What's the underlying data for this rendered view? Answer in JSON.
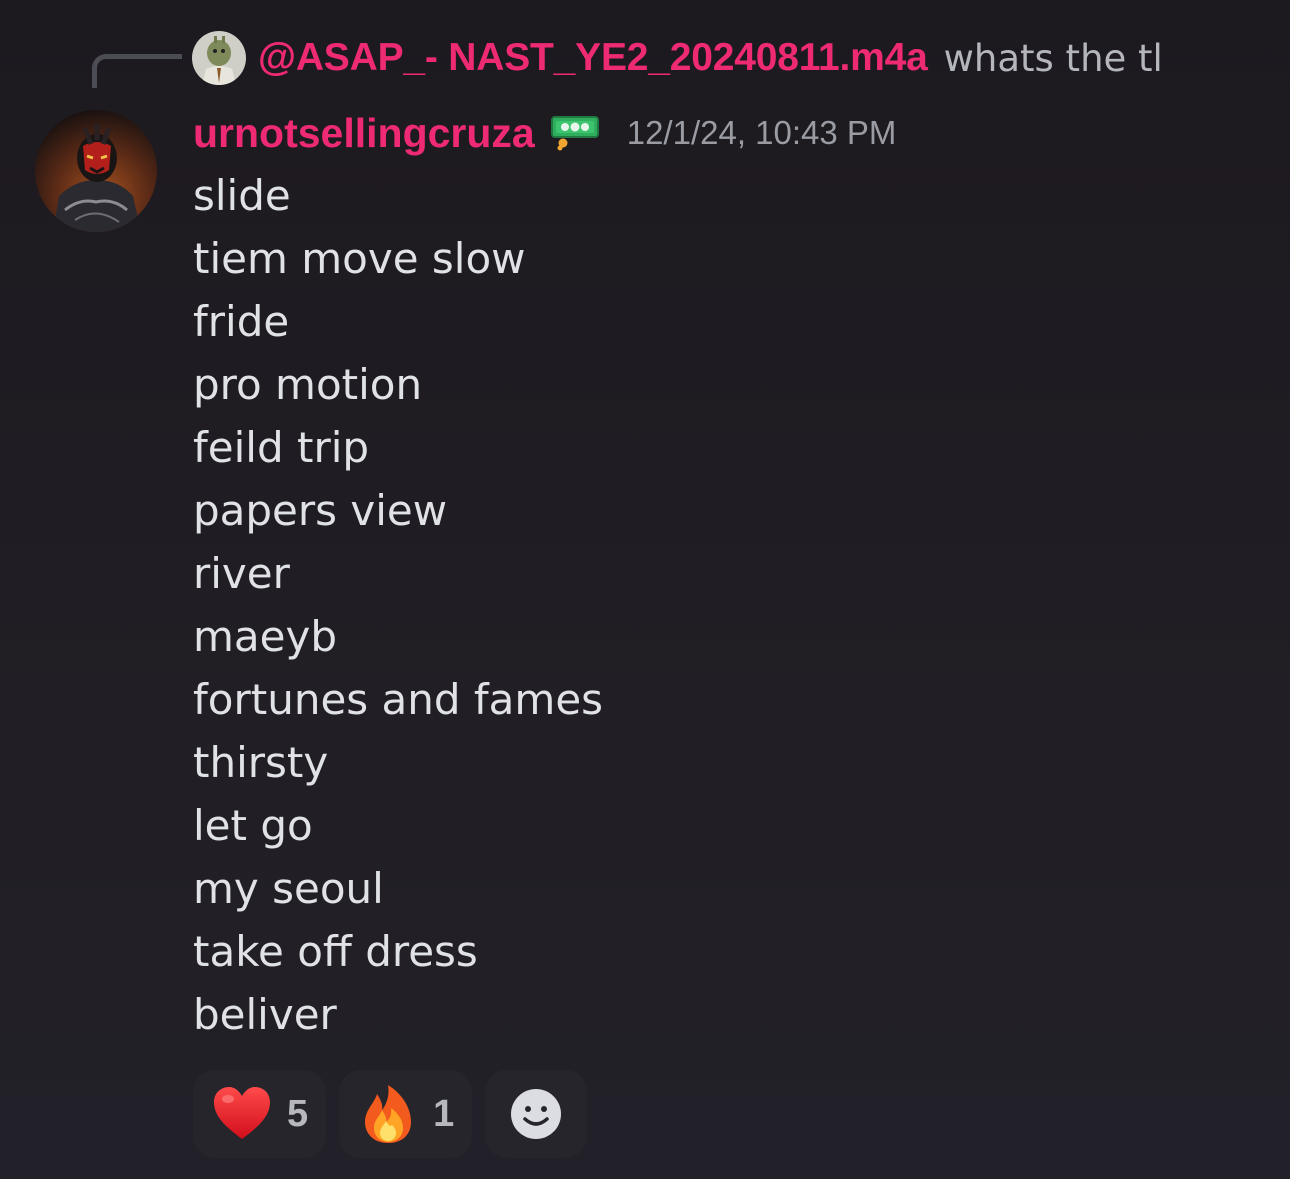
{
  "reply": {
    "author": "@ASAP_- NAST_YE2_20240811.m4a",
    "text": "whats the tl",
    "avatar_icon": "shrek-avatar-icon"
  },
  "message": {
    "username": "urnotsellingcruza",
    "badge_icon": "money-bill-icon",
    "timestamp": "12/1/24, 10:43 PM",
    "avatar_icon": "dark-figure-avatar-icon",
    "lines": [
      "slide",
      "tiem move slow",
      "fride",
      "pro motion",
      "feild trip",
      "papers view",
      "river",
      "maeyb",
      "fortunes and fames",
      "thirsty",
      "let go",
      "my seoul",
      "take off dress",
      "beliver"
    ]
  },
  "reactions": [
    {
      "emoji": "heart-icon",
      "count": "5"
    },
    {
      "emoji": "fire-icon",
      "count": "1"
    }
  ],
  "add_reaction_icon": "smiley-add-reaction-icon",
  "colors": {
    "username": "#ee2a74",
    "background": "#1f1c23",
    "reaction_bg": "#26252c"
  }
}
